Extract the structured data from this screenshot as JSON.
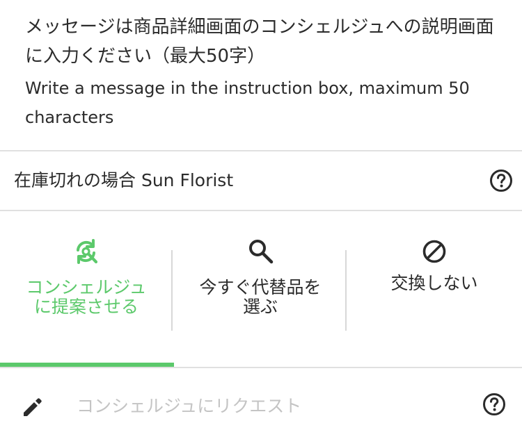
{
  "instructions": {
    "ja": "メッセージは商品詳細画面のコンシェルジュへの説明画面に入力ください（最大50字）",
    "en": "Write a message in the instruction box, maximum 50 characters"
  },
  "out_of_stock": {
    "label": "在庫切れの場合 Sun Florist"
  },
  "options": [
    {
      "label_line1": "コンシェルジュ",
      "label_line2": "に提案させる",
      "icon": "refresh-search-icon",
      "active": true
    },
    {
      "label_line1": "今すぐ代替品を",
      "label_line2": "選ぶ",
      "icon": "search-icon",
      "active": false
    },
    {
      "label_line1": "交換しない",
      "label_line2": "",
      "icon": "no-entry-icon",
      "active": false
    }
  ],
  "request": {
    "placeholder": "コンシェルジュにリクエスト",
    "value": ""
  },
  "colors": {
    "accent": "#5cc96b",
    "text": "#2b2b2b",
    "divider": "#e0e0e0",
    "placeholder": "#c4c4c4"
  }
}
